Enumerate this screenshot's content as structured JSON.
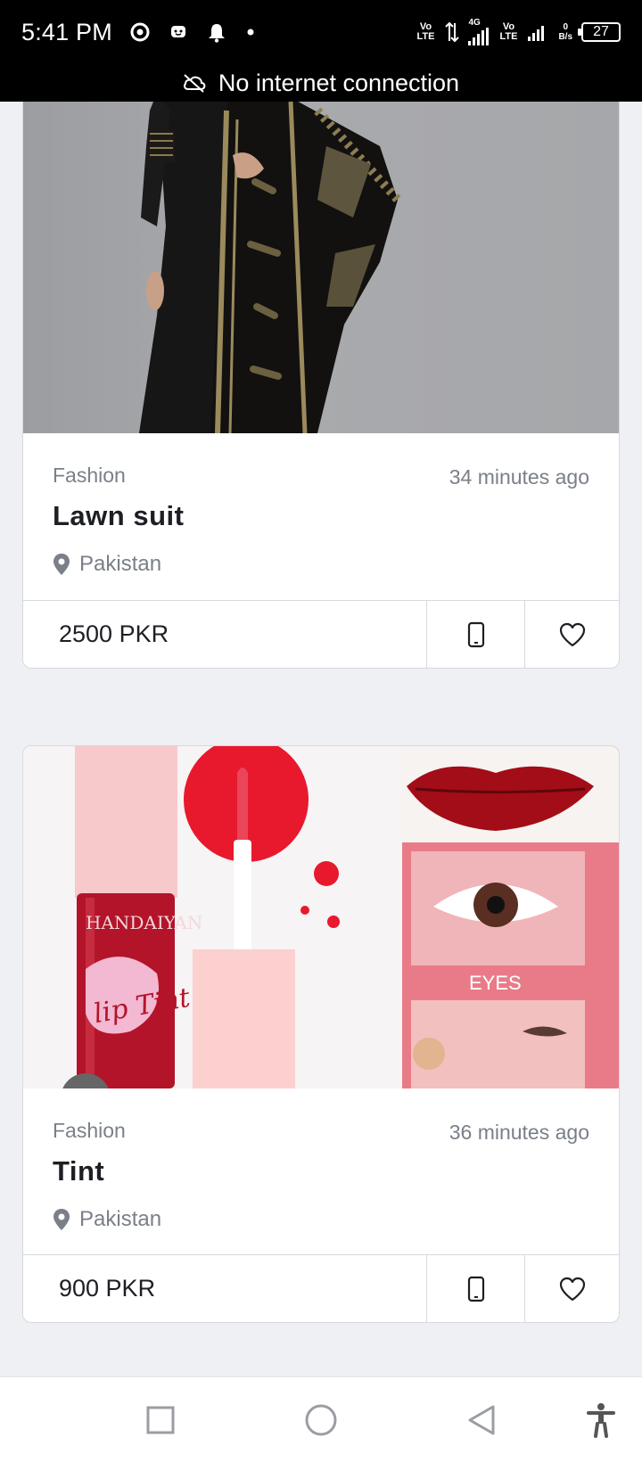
{
  "status_bar": {
    "time": "5:41 PM",
    "network_tag_1": "Vo LTE",
    "network_tag_4g": "4G",
    "network_tag_2": "Vo LTE",
    "speed_value": "0",
    "speed_unit": "B/s",
    "battery": "27",
    "icons": [
      "browser-icon",
      "messenger-icon",
      "bell-icon",
      "dot-icon",
      "data-transfer-icon",
      "signal-icon",
      "battery-icon"
    ]
  },
  "offline_banner": {
    "text": "No internet connection",
    "icon": "cloud-off-icon"
  },
  "listings": [
    {
      "category": "Fashion",
      "time": "34 minutes ago",
      "title": "Lawn suit",
      "location": "Pakistan",
      "price": "2500 PKR",
      "image": "black-embroidered-lawn-suit-photo"
    },
    {
      "category": "Fashion",
      "time": "36 minutes ago",
      "title": "Tint",
      "location": "Pakistan",
      "price": "900 PKR",
      "image": "lip-tint-product-photo",
      "image_text": {
        "brand": "HANDAIYAN",
        "product": "lip Tint",
        "eyes_label": "EYES"
      }
    }
  ],
  "actions": {
    "call_icon": "phone-icon",
    "favorite_icon": "heart-icon"
  },
  "nav_bar": {
    "icons": [
      "recent-apps-icon",
      "home-icon",
      "back-icon",
      "accessibility-icon"
    ]
  },
  "colors": {
    "text_primary": "#1d1f24",
    "text_secondary": "#7a7f88",
    "border": "#d7d9de",
    "background": "#eef0f4"
  }
}
